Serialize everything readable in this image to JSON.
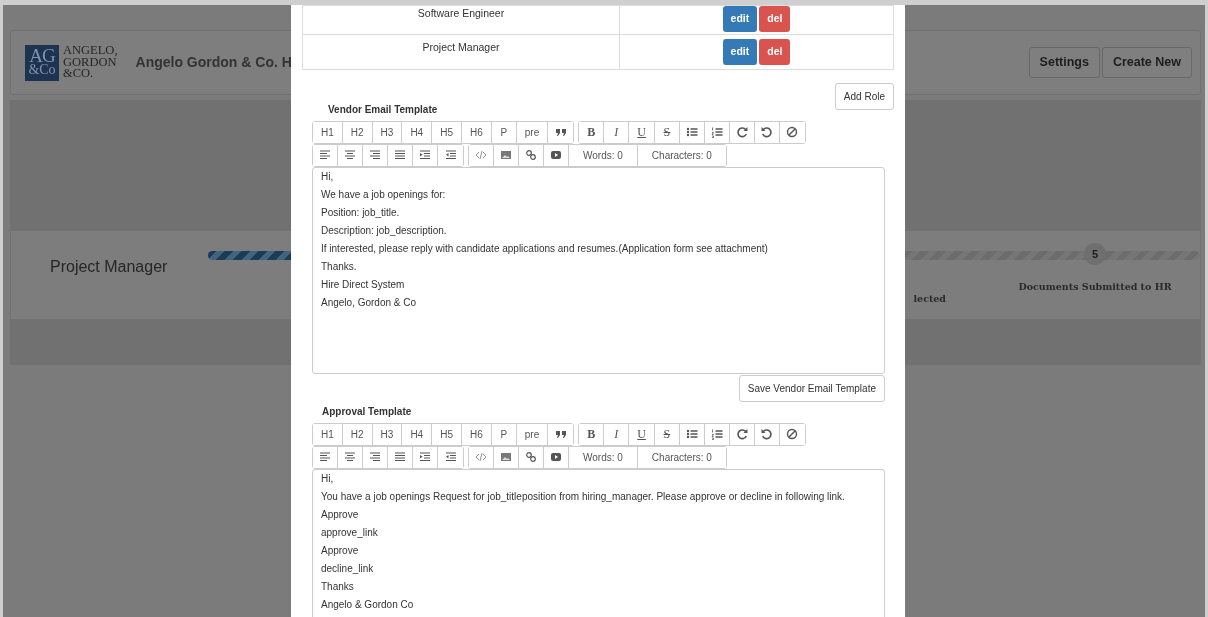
{
  "background": {
    "logo": {
      "mark_top": "AG",
      "mark_bottom": "&Co",
      "lines": [
        "ANGELO,",
        "GORDON",
        "&CO."
      ]
    },
    "title": "Angelo Gordon & Co. H",
    "header_buttons": [
      "Settings",
      "Create New"
    ],
    "stage": {
      "title": "Project Manager",
      "level": 0.4,
      "steps": [
        {
          "kind": "partial",
          "label": "lected"
        },
        {
          "kind": "numbered",
          "number": "5",
          "label": "Documents Submitted to HR"
        }
      ]
    }
  },
  "modal": {
    "roles": [
      {
        "name": "Software Engineer",
        "actions": [
          {
            "kind": "edit",
            "label": "edit"
          },
          {
            "kind": "delete",
            "label": "del"
          }
        ]
      },
      {
        "name": "Project Manager",
        "actions": [
          {
            "kind": "edit",
            "label": "edit"
          },
          {
            "kind": "delete",
            "label": "del"
          }
        ]
      }
    ],
    "add_button": "Add Role",
    "editors": [
      {
        "title": "Vendor Email Template",
        "toolbar": [
          [
            [
              {
                "kind": "text",
                "label": "H1"
              },
              {
                "kind": "text",
                "label": "H2"
              },
              {
                "kind": "text",
                "label": "H3"
              },
              {
                "kind": "text",
                "label": "H4"
              },
              {
                "kind": "text",
                "label": "H5"
              },
              {
                "kind": "text",
                "label": "H6"
              },
              {
                "kind": "text",
                "label": "P"
              },
              {
                "kind": "text",
                "label": "pre"
              },
              {
                "kind": "quote"
              }
            ],
            [
              {
                "kind": "bold",
                "label": "B"
              },
              {
                "kind": "italic",
                "label": "I"
              },
              {
                "kind": "underline",
                "label": "U"
              },
              {
                "kind": "strike",
                "label": "S"
              },
              {
                "kind": "bullets"
              },
              {
                "kind": "numbers"
              },
              {
                "kind": "redo"
              },
              {
                "kind": "undo"
              },
              {
                "kind": "clear"
              }
            ]
          ],
          [
            [
              {
                "kind": "align-left"
              },
              {
                "kind": "align-center"
              },
              {
                "kind": "align-right"
              },
              {
                "kind": "justify"
              },
              {
                "kind": "indent"
              },
              {
                "kind": "outdent"
              }
            ],
            [
              {
                "kind": "code"
              },
              {
                "kind": "image"
              },
              {
                "kind": "link"
              },
              {
                "kind": "video"
              },
              {
                "kind": "counter",
                "label": "Words: 0"
              },
              {
                "kind": "counter",
                "label": "Characters: 0"
              }
            ]
          ]
        ],
        "lines": [
          "Hi,",
          "We have a job openings for:",
          "Position: job_title.",
          "Description: job_description.",
          "If interested, please reply with candidate applications and resumes.(Application form see attachment)",
          "Thanks.",
          "Hire Direct System",
          "Angelo, Gordon & Co"
        ],
        "save_button": "Save Vendor Email Template"
      },
      {
        "title": "Approval Template",
        "toolbar": [
          [
            [
              {
                "kind": "text",
                "label": "H1"
              },
              {
                "kind": "text",
                "label": "H2"
              },
              {
                "kind": "text",
                "label": "H3"
              },
              {
                "kind": "text",
                "label": "H4"
              },
              {
                "kind": "text",
                "label": "H5"
              },
              {
                "kind": "text",
                "label": "H6"
              },
              {
                "kind": "text",
                "label": "P"
              },
              {
                "kind": "text",
                "label": "pre"
              },
              {
                "kind": "quote"
              }
            ],
            [
              {
                "kind": "bold",
                "label": "B"
              },
              {
                "kind": "italic",
                "label": "I"
              },
              {
                "kind": "underline",
                "label": "U"
              },
              {
                "kind": "strike",
                "label": "S"
              },
              {
                "kind": "bullets"
              },
              {
                "kind": "numbers"
              },
              {
                "kind": "redo"
              },
              {
                "kind": "undo"
              },
              {
                "kind": "clear"
              }
            ]
          ],
          [
            [
              {
                "kind": "align-left"
              },
              {
                "kind": "align-center"
              },
              {
                "kind": "align-right"
              },
              {
                "kind": "justify"
              },
              {
                "kind": "indent"
              },
              {
                "kind": "outdent"
              }
            ],
            [
              {
                "kind": "code"
              },
              {
                "kind": "image"
              },
              {
                "kind": "link"
              },
              {
                "kind": "video"
              },
              {
                "kind": "counter",
                "label": "Words: 0"
              },
              {
                "kind": "counter",
                "label": "Characters: 0"
              }
            ]
          ]
        ],
        "lines": [
          "Hi,",
          "You have a job openings Request for job_titleposition from hiring_manager. Please approve or decline in following link.",
          "Approve",
          "approve_link",
          "Approve",
          "decline_link",
          "Thanks",
          "Angelo & Gordon Co"
        ]
      }
    ]
  }
}
